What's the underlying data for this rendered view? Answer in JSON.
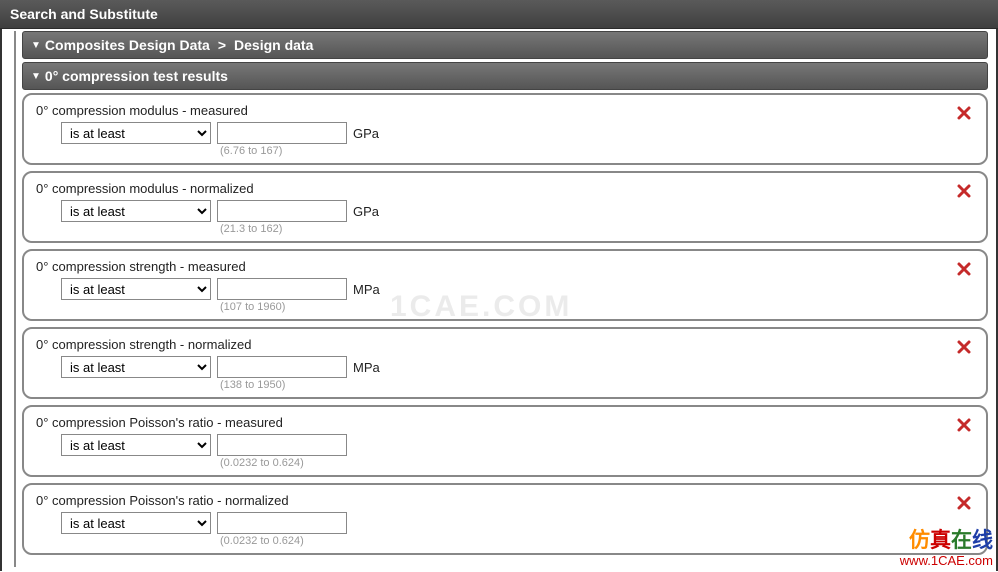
{
  "window": {
    "title": "Search and Substitute"
  },
  "breadcrumb": {
    "section1": "Composites Design Data",
    "section2": "Design data"
  },
  "subsection": {
    "title": "0° compression test results"
  },
  "default_operator": "is at least",
  "criteria": [
    {
      "label": "0° compression modulus - measured",
      "operator": "is at least",
      "value": "",
      "unit": "GPa",
      "range": "(6.76 to 167)"
    },
    {
      "label": "0° compression modulus - normalized",
      "operator": "is at least",
      "value": "",
      "unit": "GPa",
      "range": "(21.3 to 162)"
    },
    {
      "label": "0° compression strength - measured",
      "operator": "is at least",
      "value": "",
      "unit": "MPa",
      "range": "(107 to 1960)"
    },
    {
      "label": "0° compression strength - normalized",
      "operator": "is at least",
      "value": "",
      "unit": "MPa",
      "range": "(138 to 1950)"
    },
    {
      "label": "0° compression Poisson's ratio - measured",
      "operator": "is at least",
      "value": "",
      "unit": "",
      "range": "(0.0232 to 0.624)"
    },
    {
      "label": "0° compression Poisson's ratio - normalized",
      "operator": "is at least",
      "value": "",
      "unit": "",
      "range": "(0.0232 to 0.624)"
    }
  ],
  "watermark": "1CAE.COM",
  "credit": {
    "cn1": "仿",
    "cn2": "真",
    "cn3": "在",
    "cn4": "线",
    "url": "www.1CAE.com"
  }
}
